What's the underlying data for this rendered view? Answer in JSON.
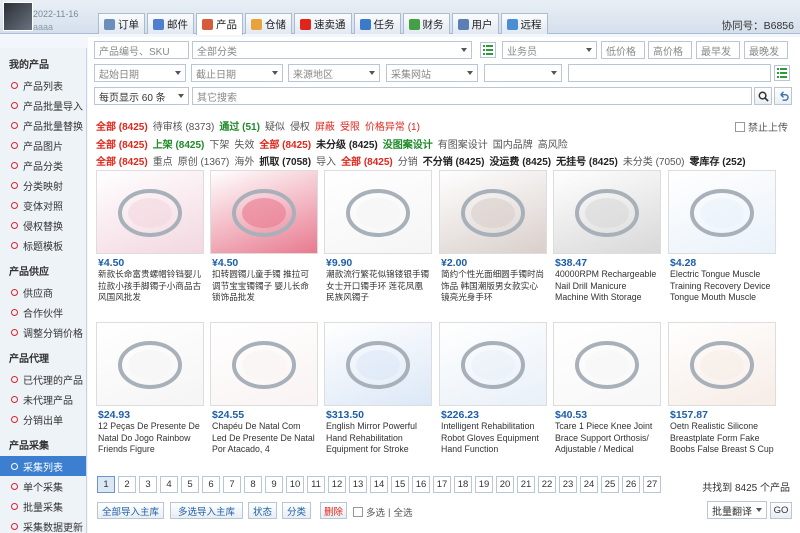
{
  "topbar": {
    "date": "2022-11-16",
    "user": "aaaa",
    "company": "协同号：B6856",
    "tabs": [
      {
        "label": "订单",
        "icon": "clipboard-icon",
        "color": "#6b8fb8"
      },
      {
        "label": "邮件",
        "icon": "mail-icon",
        "color": "#4d7ecf"
      },
      {
        "label": "产品",
        "icon": "grid-icon",
        "color": "#d65b3a"
      },
      {
        "label": "仓储",
        "icon": "warehouse-icon",
        "color": "#e8a33b"
      },
      {
        "label": "速卖通",
        "icon": "aliexpress-icon",
        "color": "#e0261c"
      },
      {
        "label": "任务",
        "icon": "task-icon",
        "color": "#3b79c9"
      },
      {
        "label": "财务",
        "icon": "finance-icon",
        "color": "#44a046"
      },
      {
        "label": "用户",
        "icon": "user-icon",
        "color": "#5b7fb5"
      },
      {
        "label": "远程",
        "icon": "remote-icon",
        "color": "#4a8ed6"
      }
    ]
  },
  "sidebar": {
    "groups": [
      {
        "title": "我的产品",
        "items": [
          "产品列表",
          "产品批量导入",
          "产品批量替换",
          "产品图片",
          "产品分类",
          "分类映射",
          "变体对照",
          "侵权替换",
          "标题模板"
        ]
      },
      {
        "title": "产品供应",
        "items": [
          "供应商",
          "合作伙伴",
          "调整分销价格"
        ]
      },
      {
        "title": "产品代理",
        "items": [
          "已代理的产品",
          "未代理产品",
          "分销出单"
        ]
      },
      {
        "title": "产品采集",
        "items": [
          "采集列表",
          "单个采集",
          "批量采集",
          "采集数据更新",
          "采集店更新"
        ]
      }
    ],
    "active": "采集列表"
  },
  "search": {
    "sku_placeholder": "产品编号、SKU",
    "category": "全部分类",
    "salesperson": "业务员",
    "min_price": "低价格",
    "max_price": "高价格",
    "min_sold": "最早发",
    "max_sold": "最晚发",
    "start_date": "起始日期",
    "end_date": "截止日期",
    "source": "来源地区",
    "collect_site": "采集网站",
    "page_size": "每页显示 60 条",
    "other_search": "其它搜索"
  },
  "filters": {
    "row1": [
      "全部 (8425)",
      "待审核 (8373)",
      "通过 (51)",
      "疑似",
      "侵权",
      "屏蔽",
      "受限",
      "价格异常 (1)"
    ],
    "row2": [
      "全部 (8425)",
      "上架 (8425)",
      "下架",
      "失效",
      "全部 (8425)",
      "未分级 (8425)",
      "没图案设计",
      "有图案设计",
      "国内品牌",
      "高风险"
    ],
    "row3": [
      "全部 (8425)",
      "重点",
      "原创 (1367)",
      "海外",
      "抓取 (7058)",
      "导入",
      "全部 (8425)",
      "分销",
      "不分销 (8425)",
      "没运费 (8425)",
      "无挂号 (8425)",
      "未分类 (7050)",
      "零库存 (252)"
    ],
    "disable_label": "禁止上传"
  },
  "products": [
    {
      "price": "¥4.50",
      "title": "新款长命富贵螺帽铃铛婴儿拉款小孩手脚镯子小商品古风国风批发",
      "en": false,
      "img": "bracelet-silver-pink",
      "color": "#f3d7e0"
    },
    {
      "price": "¥4.50",
      "title": "扣转圆镯儿童手镯 推拉可调节宝宝镯镯子 婴儿长命锁饰品批发",
      "en": false,
      "img": "bracelet-pink",
      "color": "#e87a8f"
    },
    {
      "price": "¥9.90",
      "title": "潮款流行繁花似锦镂银手镯女士开口镯手环 莲花凤凰民族风镯子",
      "en": false,
      "img": "bracelet-pair",
      "color": "#f5f5f5"
    },
    {
      "price": "¥2.00",
      "title": "简约个性光面细圆手镯时尚饰品 韩国潮版男女款实心镜亮光身手环",
      "en": false,
      "img": "bracelet-wrist",
      "color": "#d9cfcb"
    },
    {
      "price": "$38.47",
      "title": "40000RPM Rechargeable Nail Drill Manicure Machine With Storage Box",
      "en": true,
      "img": "nail-drill",
      "color": "#d8d8d8"
    },
    {
      "price": "$4.28",
      "title": "Electric Tongue Muscle Training Recovery Device Tongue Mouth Muscle",
      "en": true,
      "img": "tongue-device",
      "color": "#eaf2fa"
    },
    {
      "price": "$24.93",
      "title": "12 Peças De Presente De Natal Do Jogo Rainbow Friends Figure",
      "en": true,
      "img": "rainbow-figures",
      "color": "#f5f5f5"
    },
    {
      "price": "$24.55",
      "title": "Chapéu De Natal Com Led De Presente De Natal Por Atacado, 4",
      "en": true,
      "img": "christmas-hat",
      "color": "#faf3f3"
    },
    {
      "price": "$313.50",
      "title": "English Mirror Powerful Hand Rehabilitation Equipment for Stroke",
      "en": true,
      "img": "hand-rehab",
      "color": "#dce8f7"
    },
    {
      "price": "$226.23",
      "title": "Intelligent Rehabilitation Robot Gloves Equipment Hand Function",
      "en": true,
      "img": "robot-gloves",
      "color": "#e9f0f8"
    },
    {
      "price": "$40.53",
      "title": "Tcare 1 Piece Knee Joint Brace Support Orthosis/ Adjustable / Medical",
      "en": true,
      "img": "knee-brace",
      "color": "#f7f7f7"
    },
    {
      "price": "$157.87",
      "title": "Oetn Realistic Silicone Breastplate Form Fake Boobs False Breast S Cup",
      "en": true,
      "img": "silicone-form",
      "color": "#f7ece6"
    }
  ],
  "pagination": {
    "pages": [
      "1",
      "2",
      "3",
      "4",
      "5",
      "6",
      "7",
      "8",
      "9",
      "10",
      "11",
      "12",
      "13",
      "14",
      "15",
      "16",
      "17",
      "18",
      "19",
      "20",
      "21",
      "22",
      "23",
      "24",
      "25",
      "26",
      "27"
    ],
    "active": "1",
    "total": "共找到 8425 个产品"
  },
  "bottom": {
    "import_all": "全部导入主库",
    "import_selected": "多选导入主库",
    "status": "状态",
    "category": "分类",
    "delete": "删除",
    "multi": "多选",
    "all": "全选",
    "batch_translate": "批量翻译",
    "go": "GO"
  }
}
